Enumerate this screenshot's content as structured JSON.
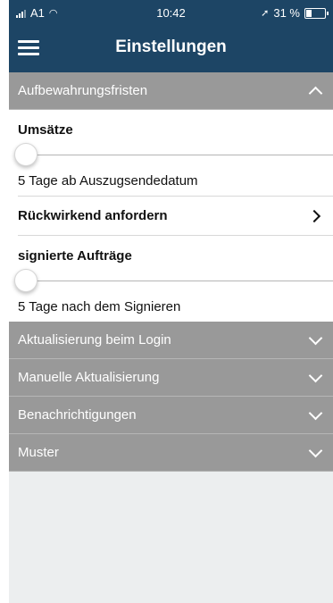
{
  "status_bar": {
    "carrier": "A1",
    "time": "10:42",
    "battery_text": "31 %",
    "battery_level": 0.31,
    "icons": [
      "signal-icon",
      "wifi-icon",
      "location-arrow-icon",
      "battery-icon"
    ]
  },
  "header": {
    "title": "Einstellungen",
    "menu_icon": "hamburger-menu-icon"
  },
  "sections": {
    "retention": {
      "label": "Aufbewahrungsfristen",
      "expanded": true,
      "transactions": {
        "label": "Umsätze",
        "slider_value": 0,
        "value_text": "5 Tage ab Auszugsendedatum"
      },
      "retroactive": {
        "label": "Rückwirkend anfordern"
      },
      "signed_orders": {
        "label": "signierte Aufträge",
        "slider_value": 0,
        "value_text": "5 Tage nach dem Signieren"
      }
    },
    "login_update": {
      "label": "Aktualisierung beim Login",
      "expanded": false
    },
    "manual_update": {
      "label": "Manuelle Aktualisierung",
      "expanded": false
    },
    "notifications": {
      "label": "Benachrichtigungen",
      "expanded": false
    },
    "templates": {
      "label": "Muster",
      "expanded": false
    }
  },
  "colors": {
    "header_bg": "#1d4565",
    "section_bg": "#999999",
    "slider_accent": "#d0342c",
    "page_bg": "#eceeef"
  }
}
